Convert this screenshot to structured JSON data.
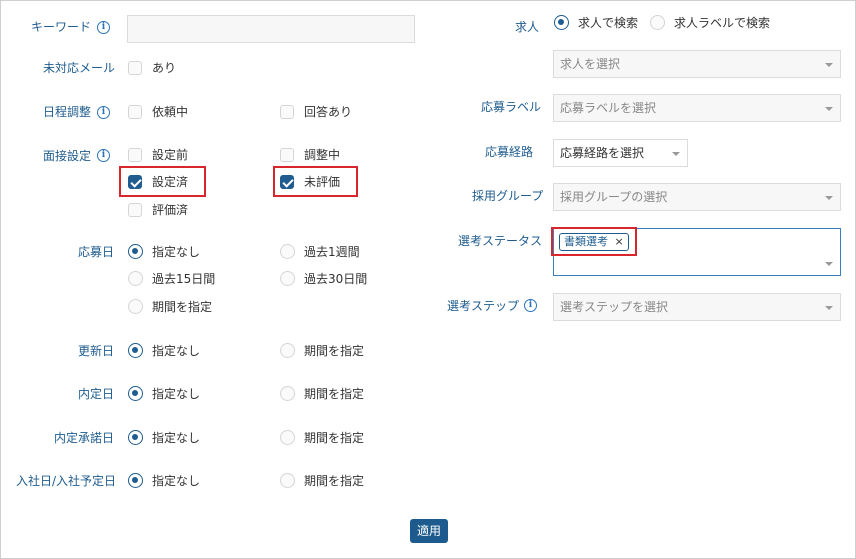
{
  "left": {
    "keyword": {
      "label": "キーワード",
      "value": ""
    },
    "unanswered_mail": {
      "label": "未対応メール",
      "option": "あり"
    },
    "schedule": {
      "label": "日程調整",
      "options": [
        "依頼中",
        "回答あり"
      ]
    },
    "interview": {
      "label": "面接設定",
      "options": [
        "設定前",
        "調整中",
        "設定済",
        "未評価",
        "評価済"
      ]
    },
    "apply_date": {
      "label": "応募日",
      "options": [
        "指定なし",
        "過去1週間",
        "過去15日間",
        "過去30日間",
        "期間を指定"
      ]
    },
    "updated_date": {
      "label": "更新日",
      "options": [
        "指定なし",
        "期間を指定"
      ]
    },
    "offer_date": {
      "label": "内定日",
      "options": [
        "指定なし",
        "期間を指定"
      ]
    },
    "offer_accept_date": {
      "label": "内定承諾日",
      "options": [
        "指定なし",
        "期間を指定"
      ]
    },
    "join_date": {
      "label": "入社日/入社予定日",
      "options": [
        "指定なし",
        "期間を指定"
      ]
    }
  },
  "right": {
    "job": {
      "label": "求人",
      "options": [
        "求人で検索",
        "求人ラベルで検索"
      ],
      "placeholder": "求人を選択"
    },
    "apply_label": {
      "label": "応募ラベル",
      "placeholder": "応募ラベルを選択"
    },
    "apply_route": {
      "label": "応募経路",
      "placeholder": "応募経路を選択"
    },
    "hiring_group": {
      "label": "採用グループ",
      "placeholder": "採用グループの選択"
    },
    "selection_status": {
      "label": "選考ステータス",
      "chip": "書類選考",
      "chip_close": "×"
    },
    "selection_step": {
      "label": "選考ステップ",
      "placeholder": "選考ステップを選択"
    }
  },
  "apply_button": "適用",
  "info_icon_glyph": "i",
  "colors": {
    "primary": "#1f5c8f",
    "highlight": "#d9262c"
  }
}
